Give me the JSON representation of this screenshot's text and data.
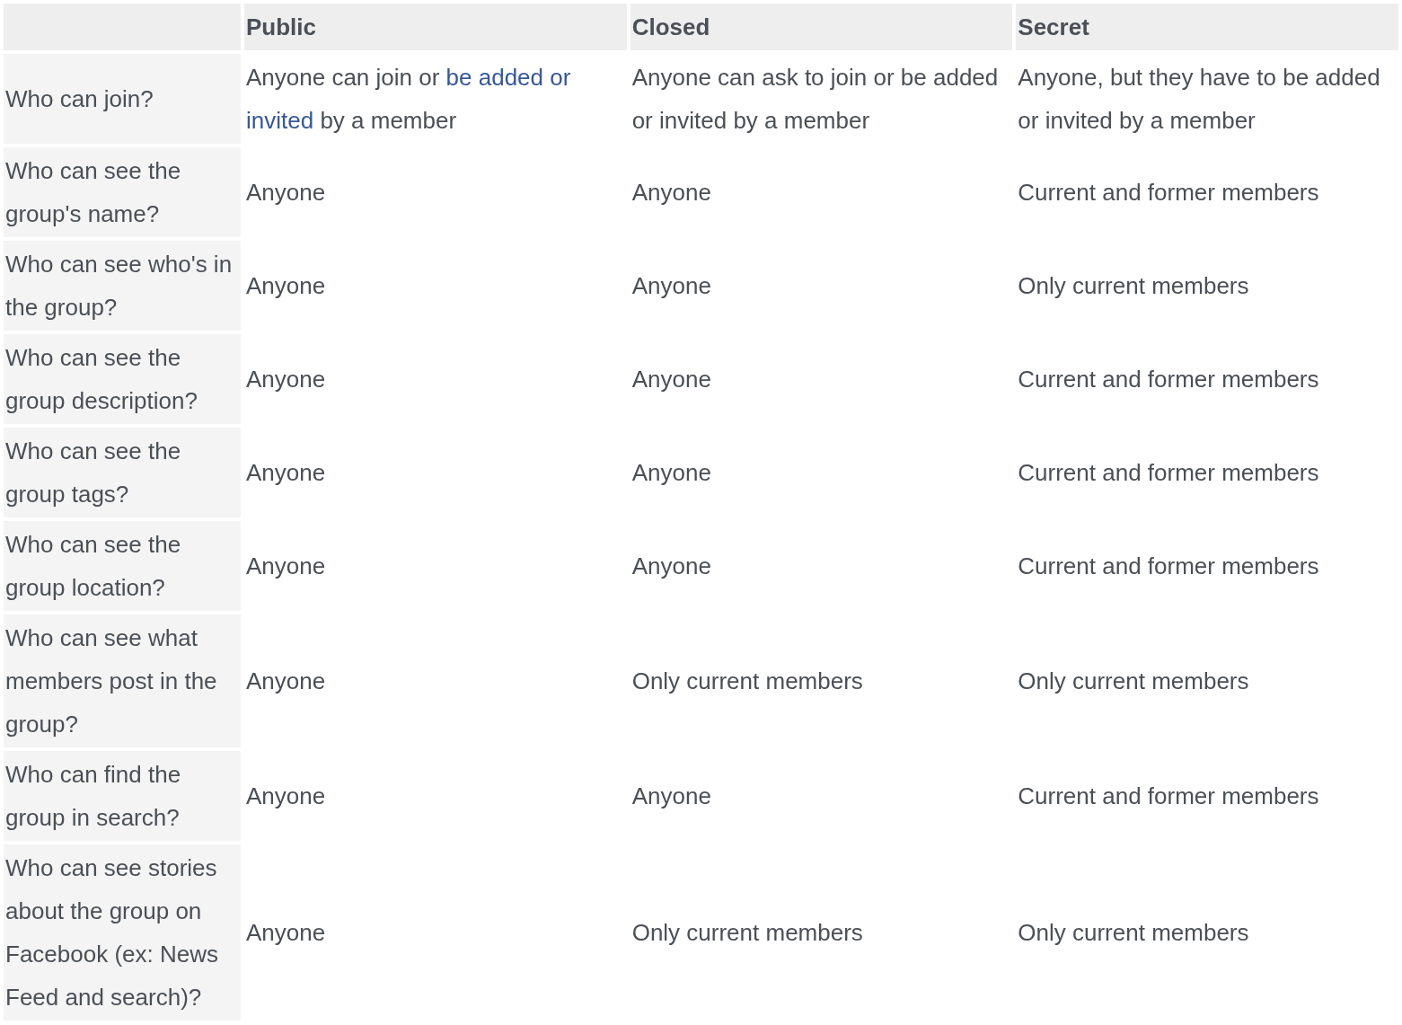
{
  "columns": [
    "Public",
    "Closed",
    "Secret"
  ],
  "rows": [
    {
      "question": "Who can join?",
      "cells": [
        [
          {
            "text": "Anyone can join or ",
            "kind": "plain"
          },
          {
            "text": "be added or",
            "kind": "link"
          },
          {
            "text": " ",
            "kind": "plain"
          },
          {
            "text": "invited",
            "kind": "link"
          },
          {
            "text": " by a member",
            "kind": "plain"
          }
        ],
        "Anyone can ask to join or be added or invited by a member",
        "Anyone, but they have to be added or invited by a member"
      ]
    },
    {
      "question": "Who can see the group's name?",
      "cells": [
        "Anyone",
        "Anyone",
        "Current and former members"
      ]
    },
    {
      "question": "Who can see who's in the group?",
      "cells": [
        "Anyone",
        "Anyone",
        "Only current members"
      ]
    },
    {
      "question": "Who can see the group description?",
      "cells": [
        "Anyone",
        "Anyone",
        "Current and former members"
      ]
    },
    {
      "question": "Who can see the group tags?",
      "cells": [
        "Anyone",
        "Anyone",
        "Current and former members"
      ]
    },
    {
      "question": "Who can see the group location?",
      "cells": [
        "Anyone",
        "Anyone",
        "Current and former members"
      ]
    },
    {
      "question": "Who can see what members post in the group?",
      "cells": [
        "Anyone",
        "Only current members",
        "Only current members"
      ]
    },
    {
      "question": "Who can find the group in search?",
      "cells": [
        "Anyone",
        "Anyone",
        "Current and former members"
      ]
    },
    {
      "question": "Who can see stories about the group on Facebook (ex: News Feed and search)?",
      "cells": [
        "Anyone",
        "Only current members",
        "Only current members"
      ]
    }
  ]
}
